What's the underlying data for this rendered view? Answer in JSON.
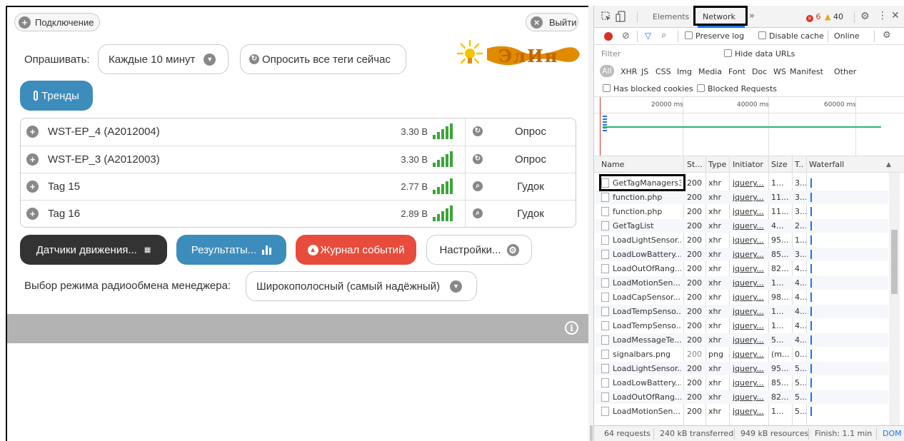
{
  "app": {
    "connect_label": "Подключение",
    "logout_label": "Выйти",
    "poll_label": "Опрашивать:",
    "poll_interval": "Каждые 10 минут",
    "poll_all_label": "Опросить все теги сейчас",
    "logo_text": "ЭлИн",
    "trends_label": "Тренды",
    "tags": [
      {
        "name": "WST-EP_4 (A2012004)",
        "voltage": "3.30 В",
        "action": "Опрос"
      },
      {
        "name": "WST-EP_3 (A2012003)",
        "voltage": "3.30 В",
        "action": "Опрос"
      },
      {
        "name": "Tag 15",
        "voltage": "2.77 В",
        "action": "Гудок"
      },
      {
        "name": "Tag 16",
        "voltage": "2.89 В",
        "action": "Гудок"
      }
    ],
    "motion_label": "Датчики движения...",
    "results_label": "Результаты...",
    "journal_label": "Журнал событий",
    "settings_label": "Настройки...",
    "radio_label": "Выбор режима радиообмена менеджера:",
    "radio_value": "Широкополосный (самый надёжный)",
    "colors": {
      "blue": "#3c8dbc",
      "dark": "#333333",
      "red": "#e74c3c",
      "gray_bar": "#b3b3b3"
    }
  },
  "devtools": {
    "tabs": {
      "elements": "Elements",
      "network": "Network",
      "more": "»"
    },
    "errors": "6",
    "warnings": "40",
    "toolbar": {
      "preserve_log": "Preserve log",
      "disable_cache": "Disable cache",
      "online": "Online"
    },
    "filter_placeholder": "Filter",
    "hide_data_urls": "Hide data URLs",
    "type_filters": [
      "All",
      "XHR",
      "JS",
      "CSS",
      "Img",
      "Media",
      "Font",
      "Doc",
      "WS",
      "Manifest",
      "Other"
    ],
    "has_blocked_cookies": "Has blocked cookies",
    "blocked_requests": "Blocked Requests",
    "timeline_ticks": [
      "20000 ms",
      "40000 ms",
      "60000 ms"
    ],
    "columns": {
      "name": "Name",
      "status": "St...",
      "type": "Type",
      "initiator": "Initiator",
      "size": "Size",
      "time": "T..",
      "waterfall": "Waterfall"
    },
    "rows": [
      {
        "name": "GetTagManagers3",
        "status": "200",
        "type": "xhr",
        "initiator": "jquery...",
        "size": "1...",
        "time": "3..."
      },
      {
        "name": "function.php",
        "status": "200",
        "type": "xhr",
        "initiator": "jquery...",
        "size": "11...",
        "time": "3..."
      },
      {
        "name": "function.php",
        "status": "200",
        "type": "xhr",
        "initiator": "jquery...",
        "size": "11...",
        "time": "3..."
      },
      {
        "name": "GetTagList",
        "status": "200",
        "type": "xhr",
        "initiator": "jquery...",
        "size": "4...",
        "time": "2..."
      },
      {
        "name": "LoadLightSensor...",
        "status": "200",
        "type": "xhr",
        "initiator": "jquery...",
        "size": "95...",
        "time": "1..."
      },
      {
        "name": "LoadLowBattery...",
        "status": "200",
        "type": "xhr",
        "initiator": "jquery...",
        "size": "85...",
        "time": "3..."
      },
      {
        "name": "LoadOutOfRang...",
        "status": "200",
        "type": "xhr",
        "initiator": "jquery...",
        "size": "82...",
        "time": "4..."
      },
      {
        "name": "LoadMotionSen...",
        "status": "200",
        "type": "xhr",
        "initiator": "jquery...",
        "size": "1...",
        "time": "4..."
      },
      {
        "name": "LoadCapSensor...",
        "status": "200",
        "type": "xhr",
        "initiator": "jquery...",
        "size": "98...",
        "time": "4..."
      },
      {
        "name": "LoadTempSenso...",
        "status": "200",
        "type": "xhr",
        "initiator": "jquery...",
        "size": "1...",
        "time": "4..."
      },
      {
        "name": "LoadTempSenso...",
        "status": "200",
        "type": "xhr",
        "initiator": "jquery...",
        "size": "1...",
        "time": "4..."
      },
      {
        "name": "LoadMessageTe...",
        "status": "200",
        "type": "xhr",
        "initiator": "jquery...",
        "size": "5...",
        "time": "4..."
      },
      {
        "name": "signalbars.png",
        "status": "200",
        "type": "png",
        "initiator": "jquery...",
        "size": "(m...",
        "time": "0..."
      },
      {
        "name": "LoadLightSensor...",
        "status": "200",
        "type": "xhr",
        "initiator": "jquery...",
        "size": "95...",
        "time": "5..."
      },
      {
        "name": "LoadLowBattery...",
        "status": "200",
        "type": "xhr",
        "initiator": "jquery...",
        "size": "85...",
        "time": "5..."
      },
      {
        "name": "LoadOutOfRang...",
        "status": "200",
        "type": "xhr",
        "initiator": "jquery...",
        "size": "82...",
        "time": "5..."
      },
      {
        "name": "LoadMotionSen...",
        "status": "200",
        "type": "xhr",
        "initiator": "jquery...",
        "size": "1...",
        "time": "5..."
      }
    ],
    "footer": {
      "requests": "64 requests",
      "transferred": "240 kB transferred",
      "resources": "949 kB resources",
      "finish": "Finish: 1.1 min",
      "dom": "DOM"
    }
  }
}
